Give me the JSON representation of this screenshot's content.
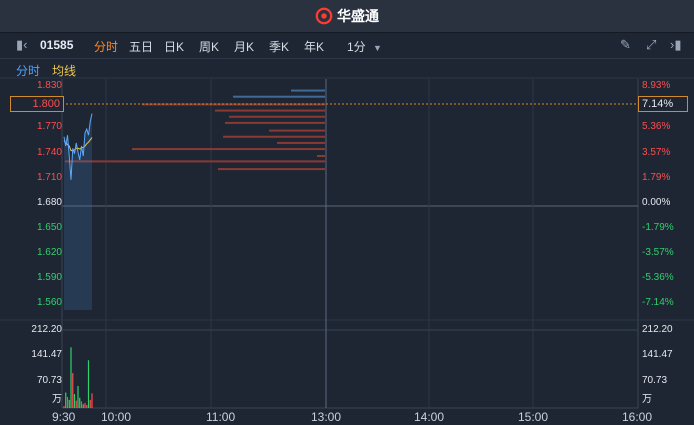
{
  "app": {
    "brand": "华盛通"
  },
  "toolbar": {
    "stock_code": "01585",
    "periods": [
      "分时",
      "五日",
      "日K",
      "周K",
      "月K",
      "季K",
      "年K"
    ],
    "active_period": "分时",
    "interval": "1分"
  },
  "subtabs": {
    "time": "分时",
    "avg": "均线"
  },
  "price_axis": {
    "labels": [
      "1.830",
      "1.800",
      "1.770",
      "1.740",
      "1.710",
      "1.680",
      "1.650",
      "1.620",
      "1.590",
      "1.560"
    ],
    "percents": [
      "8.93%",
      "7.14%",
      "5.36%",
      "3.57%",
      "1.79%",
      "0.00%",
      "-1.79%",
      "-3.57%",
      "-5.36%",
      "-7.14%"
    ],
    "highlight_price": "1.800",
    "highlight_percent": "7.14%"
  },
  "volume_axis": {
    "labels": [
      "212.20",
      "141.47",
      "70.73"
    ],
    "unit": "万"
  },
  "time_axis": [
    "9:30",
    "10:00",
    "11:00",
    "13:00",
    "14:00",
    "15:00",
    "16:00"
  ],
  "colors": {
    "up": "#ff4d4d",
    "down": "#2fd16b",
    "accent": "#ff8a1f",
    "price_line": "#5aa9ff",
    "avg_line": "#f0c84a"
  },
  "chart_data": {
    "type": "line",
    "x_range": [
      "9:30",
      "16:00"
    ],
    "y_range": [
      1.545,
      1.845
    ],
    "prev_close": 1.68,
    "series": [
      {
        "values": [
          1.77,
          1.758,
          1.772,
          1.745,
          1.714,
          1.755,
          1.748,
          1.762,
          1.75,
          1.74,
          1.758,
          1.745,
          1.775,
          1.78,
          1.772,
          1.79,
          1.8
        ]
      },
      {
        "values": [
          1.765,
          1.762,
          1.76,
          1.758,
          1.752,
          1.752,
          1.753,
          1.755,
          1.755,
          1.754,
          1.756,
          1.756,
          1.758,
          1.761,
          1.763,
          1.766,
          1.769
        ]
      }
    ],
    "volume": [
      5,
      42,
      30,
      22,
      165,
      95,
      38,
      20,
      60,
      28,
      18,
      10,
      14,
      8,
      130,
      22,
      40
    ],
    "volume_range": [
      0,
      212.2
    ],
    "price_distribution": [
      {
        "price": 1.83,
        "width": 34,
        "color": "blue"
      },
      {
        "price": 1.822,
        "width": 92,
        "color": "blue"
      },
      {
        "price": 1.812,
        "width": 183,
        "color": "red"
      },
      {
        "price": 1.804,
        "width": 110,
        "color": "red"
      },
      {
        "price": 1.796,
        "width": 96,
        "color": "red"
      },
      {
        "price": 1.788,
        "width": 100,
        "color": "red"
      },
      {
        "price": 1.778,
        "width": 56,
        "color": "red"
      },
      {
        "price": 1.77,
        "width": 102,
        "color": "red"
      },
      {
        "price": 1.762,
        "width": 48,
        "color": "red"
      },
      {
        "price": 1.754,
        "width": 193,
        "color": "red"
      },
      {
        "price": 1.745,
        "width": 8,
        "color": "red"
      },
      {
        "price": 1.738,
        "width": 260,
        "color": "red"
      },
      {
        "price": 1.728,
        "width": 107,
        "color": "red"
      }
    ]
  }
}
